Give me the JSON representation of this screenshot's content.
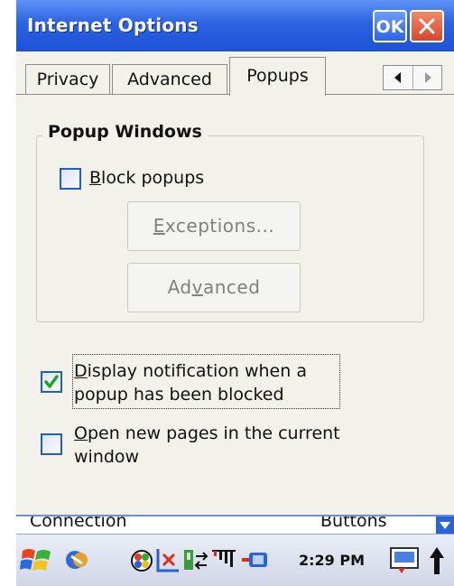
{
  "window": {
    "title": "Internet Options",
    "ok_label": "OK"
  },
  "tabs": [
    {
      "label": "Privacy",
      "active": false
    },
    {
      "label": "Advanced",
      "active": false
    },
    {
      "label": "Popups",
      "active": true
    }
  ],
  "popup_windows": {
    "group_title": "Popup Windows",
    "block_popups": {
      "label_prefix": "B",
      "label_rest": "lock popups",
      "checked": false
    },
    "exceptions_button": {
      "label_prefix": "E",
      "label_rest": "xceptions...",
      "enabled": false
    },
    "advanced_button": {
      "label_pre": "Ad",
      "label_u": "v",
      "label_rest": "anced",
      "enabled": false
    }
  },
  "display_notification": {
    "line1_prefix": "D",
    "line1_rest": "isplay notification when a",
    "line2": "popup has been blocked",
    "checked": true
  },
  "open_new_pages": {
    "line1_prefix": "O",
    "line1_rest": "pen new pages in the current",
    "line2": "window",
    "checked": false
  },
  "menu": {
    "left": "Connection",
    "right": "Buttons"
  },
  "taskbar": {
    "time": "2:29 PM",
    "icons": [
      "start-icon",
      "sync-icon",
      "network-icon",
      "no-connection-icon",
      "activesync-icon",
      "signal-icon",
      "battery-icon",
      "keyboard-icon",
      "input-arrow-icon"
    ]
  },
  "colors": {
    "titlebar": "#2c63e0",
    "background": "#f2f1ea",
    "check_border": "#1f5fc0",
    "check_mark": "#21a121"
  }
}
